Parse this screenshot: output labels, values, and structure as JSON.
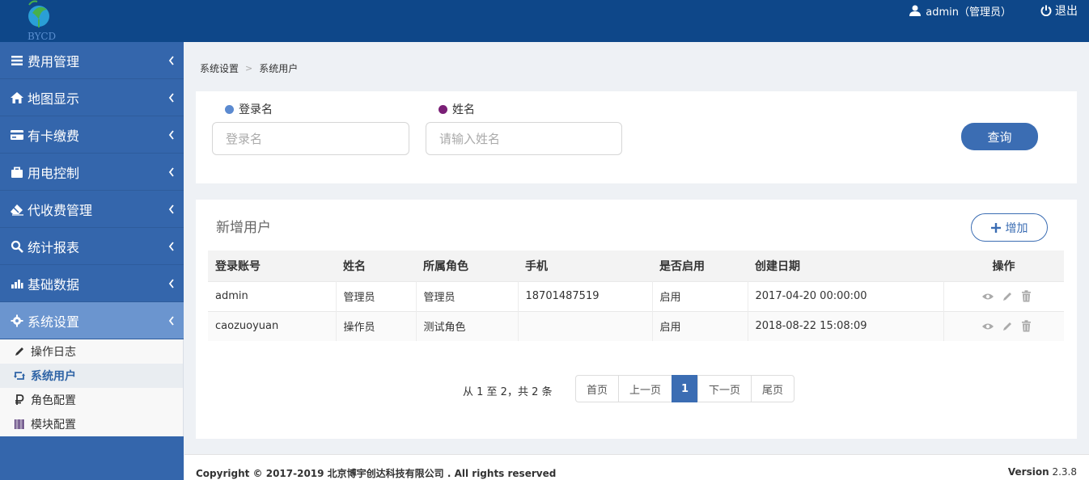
{
  "header": {
    "logo_text": "BYCD",
    "user": "admin（管理员）",
    "logout": "退出"
  },
  "sidebar": {
    "items": [
      {
        "label": "费用管理",
        "icon": "list-icon"
      },
      {
        "label": "地图显示",
        "icon": "home-icon"
      },
      {
        "label": "有卡缴费",
        "icon": "credit-card-icon"
      },
      {
        "label": "用电控制",
        "icon": "briefcase-icon"
      },
      {
        "label": "代收费管理",
        "icon": "eraser-icon"
      },
      {
        "label": "统计报表",
        "icon": "search-icon"
      },
      {
        "label": "基础数据",
        "icon": "tasks-icon"
      },
      {
        "label": "系统设置",
        "icon": "gear-icon"
      }
    ],
    "sub_items": [
      {
        "label": "操作日志",
        "icon": "pencil-icon"
      },
      {
        "label": "系统用户",
        "icon": "retweet-icon"
      },
      {
        "label": "角色配置",
        "icon": "ruble-icon"
      },
      {
        "label": "模块配置",
        "icon": "barcode-icon"
      }
    ]
  },
  "breadcrumb": [
    "系统设置",
    "系统用户"
  ],
  "search": {
    "login_label": "登录名",
    "login_placeholder": "登录名",
    "name_label": "姓名",
    "name_placeholder": "请输入姓名",
    "query_button": "查询",
    "colors": {
      "login_dot": "#5b8ad0",
      "name_dot": "#7a1f76"
    }
  },
  "table_panel": {
    "title": "新增用户",
    "add_button": "增加",
    "columns": [
      "登录账号",
      "姓名",
      "所属角色",
      "手机",
      "是否启用",
      "创建日期",
      "操作"
    ],
    "rows": [
      {
        "account": "admin",
        "name": "管理员",
        "role": "管理员",
        "phone": "18701487519",
        "enabled": "启用",
        "created": "2017-04-20 00:00:00"
      },
      {
        "account": "caozuoyuan",
        "name": "操作员",
        "role": "测试角色",
        "phone": "",
        "enabled": "启用",
        "created": "2018-08-22 15:08:09"
      }
    ]
  },
  "pagination": {
    "info": "从 1 至 2，共 2 条",
    "first": "首页",
    "prev": "上一页",
    "current": "1",
    "next": "下一页",
    "last": "尾页"
  },
  "footer": {
    "copyright": "Copyright © 2017-2019  北京博宇创达科技有限公司   . All rights reserved",
    "version_label": "Version",
    "version_value": "2.3.8"
  }
}
